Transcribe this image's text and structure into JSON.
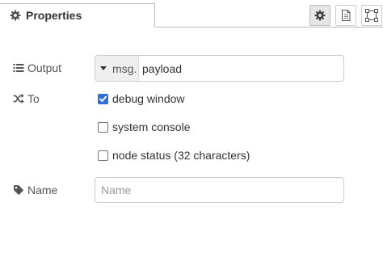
{
  "tabs": [
    {
      "label": "Properties",
      "icon": "gear-icon"
    }
  ],
  "toolbar": {
    "buttons": [
      {
        "icon": "gear-icon",
        "active": true
      },
      {
        "icon": "document-icon",
        "active": false
      },
      {
        "icon": "frame-icon",
        "active": false
      }
    ]
  },
  "form": {
    "output": {
      "label": "Output",
      "icon": "list-icon",
      "type_prefix": "msg.",
      "value": "payload"
    },
    "to": {
      "label": "To",
      "icon": "shuffle-icon",
      "options": [
        {
          "label": "debug window",
          "checked": true
        },
        {
          "label": "system console",
          "checked": false
        },
        {
          "label": "node status (32 characters)",
          "checked": false
        }
      ]
    },
    "name": {
      "label": "Name",
      "icon": "tag-icon",
      "placeholder": "Name",
      "value": ""
    }
  },
  "colors": {
    "accent": "#2f6fd6",
    "border": "#cccccc"
  }
}
